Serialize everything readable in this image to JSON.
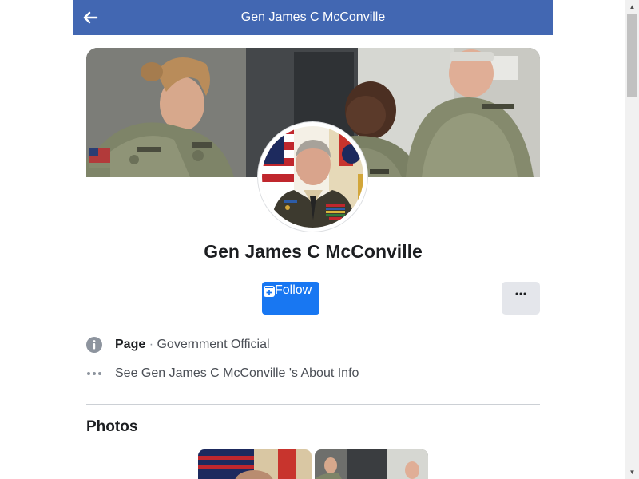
{
  "header": {
    "title": "Gen James C McConville",
    "back_icon": "arrow-left-icon",
    "background": "#4267b2"
  },
  "profile": {
    "name": "Gen James C McConville",
    "cover_image": "soldiers-group-photo",
    "avatar_image": "general-portrait"
  },
  "actions": {
    "follow_label": "Follow",
    "follow_icon": "follow-plus-icon",
    "more_label": "···",
    "accent": "#1877f2"
  },
  "info": {
    "page_label": "Page",
    "separator": " · ",
    "category": "Government Official",
    "about_link": "See Gen James C McConville 's About Info",
    "page_icon": "info-circle-icon",
    "about_icon": "more-dots-icon"
  },
  "photos": {
    "title": "Photos"
  },
  "scrollbar": {
    "up_arrow": "▲",
    "down_arrow": "▼"
  }
}
